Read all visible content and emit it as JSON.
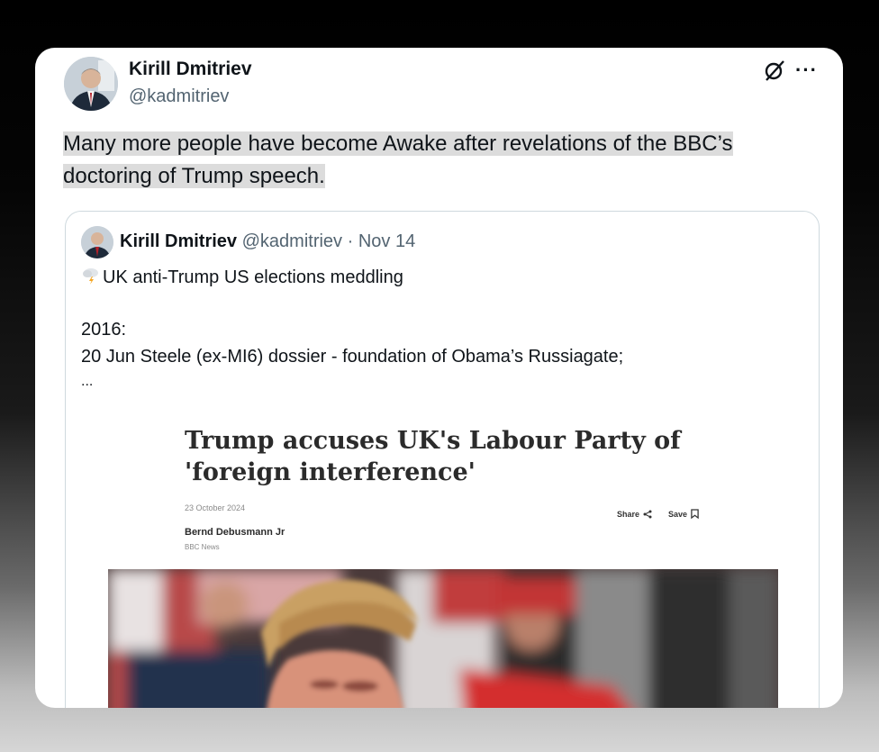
{
  "post": {
    "author_name": "Kirill Dmitriev",
    "author_handle": "@kadmitriev",
    "text": "Many more people have become Awake after revelations of the BBC’s doctoring of Trump speech.",
    "icons": [
      "grok-icon",
      "more-icon"
    ],
    "more_label": "···"
  },
  "quote": {
    "author_name": "Kirill Dmitriev",
    "author_handle": "@kadmitriev",
    "separator": "·",
    "date": "Nov 14",
    "line1": "UK anti-Trump US elections meddling",
    "line1_icon": "storm-cloud-icon",
    "line2": "2016:",
    "line3": "20 Jun Steele (ex-MI6) dossier - foundation of Obama’s Russiagate;",
    "line4": "..."
  },
  "article": {
    "title": "Trump accuses UK's Labour Party of 'foreign interference'",
    "date": "23 October 2024",
    "share_label": "Share",
    "save_label": "Save",
    "author": "Bernd Debusmann Jr",
    "outlet": "BBC News"
  }
}
